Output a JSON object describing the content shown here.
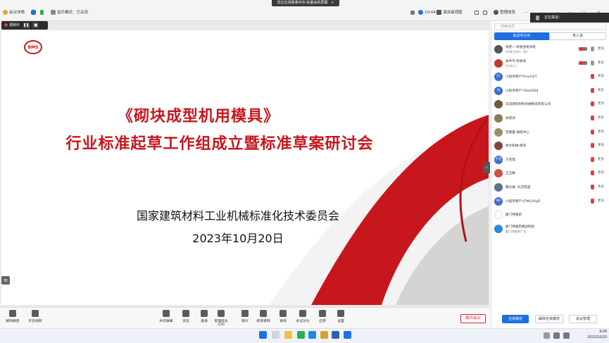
{
  "share_banner": {
    "text": "您正在观看泰中杰-标委会的屏幕",
    "close_icon": "×"
  },
  "topbar": {
    "meeting_info": "会议详情",
    "music_mode": "音乐模式：已关闭",
    "time": "10:04",
    "speaker_view": "演讲者视图",
    "manage_members": "管理成员"
  },
  "recording": {
    "label": "录制中",
    "pause": "❚❚",
    "stop": "■"
  },
  "slide": {
    "title_line1": "《砌块成型机用模具》",
    "title_line2": "行业标准起草工作组成立暨标准草案研讨会",
    "org": "国家建筑材料工业机械标准化技术委员会",
    "date": "2023年10月20日",
    "logo_text": "BMS"
  },
  "toolbar": {
    "tools": [
      {
        "label": "解除静音",
        "icon": "mic-off-icon"
      },
      {
        "label": "开启视频",
        "icon": "video-off-icon"
      },
      {
        "label": "共享屏幕",
        "icon": "share-screen-icon"
      },
      {
        "label": "安全",
        "icon": "shield-icon"
      },
      {
        "label": "邀请",
        "icon": "invite-icon"
      },
      {
        "label": "管理成员(14)",
        "icon": "members-icon"
      },
      {
        "label": "聊天",
        "icon": "chat-icon"
      },
      {
        "label": "结束录制",
        "icon": "record-icon"
      },
      {
        "label": "表情",
        "icon": "emoji-icon"
      },
      {
        "label": "会议讨论",
        "icon": "discussion-icon"
      },
      {
        "label": "应用",
        "icon": "apps-icon"
      },
      {
        "label": "设置",
        "icon": "gear-icon"
      }
    ],
    "leave": "离开会议"
  },
  "panel": {
    "speaking": "正在讲话：",
    "search_placeholder": "搜索成员",
    "tab_in": "会议中(14)",
    "tab_out": "未入会",
    "members": [
      {
        "name": "张老一-标委会秘书处",
        "sub": "(共享主持人, 我)",
        "color": "#555555",
        "mic": "on",
        "video": true
      },
      {
        "name": "泰中杰-标委会",
        "sub": "(主持人)",
        "color": "#c0392b",
        "mic": "on",
        "video": true
      },
      {
        "name": "小程序用户*tmLA2/Y",
        "sub": "",
        "color": "#3b6fc9",
        "avatar": "ZY",
        "mic": "off"
      },
      {
        "name": "小程序用户*3Sw56S/J",
        "sub": "",
        "color": "#3b6fc9",
        "avatar": "9J",
        "mic": "off"
      },
      {
        "name": "华润建筑材料机械制造有限公司",
        "sub": "",
        "color": "#6b5b3a",
        "mic": "off"
      },
      {
        "name": "徐景涛",
        "sub": "",
        "color": "#8a7a5a",
        "mic": "off"
      },
      {
        "name": "克赫曼-质检中心",
        "sub": "",
        "color": "#9a8f6e",
        "mic": "off"
      },
      {
        "name": "陕文机械-杨哥",
        "sub": "",
        "color": "#7d4a3a",
        "mic": "off"
      },
      {
        "name": "方佳琪",
        "sub": "",
        "color": "#3b6fc9",
        "avatar": "方佳",
        "mic": "off"
      },
      {
        "name": "王玉敏",
        "sub": "",
        "color": "#c9544a",
        "mic": "off"
      },
      {
        "name": "魏文斌--北京凯盛",
        "sub": "",
        "color": "#5a7090",
        "mic": "off"
      },
      {
        "name": "小程序用户*J7Mt2/AgD",
        "sub": "",
        "color": "#3b6fc9",
        "avatar": "NO",
        "mic": "off"
      },
      {
        "name": "厦门特维昂",
        "sub": "",
        "color": "#ffffff",
        "mic": "none"
      },
      {
        "name": "厦门特维昂模具制造",
        "sub": "厦门特维昂厂长",
        "color": "#2b8ad6",
        "mic": "none"
      }
    ],
    "member_more": "更多",
    "mute_all": "全体静音",
    "unmute_all": "解除全体静音",
    "meeting_manage": "会议管理"
  },
  "taskbar": {
    "time": "9:00",
    "date": "2023/10/20"
  }
}
